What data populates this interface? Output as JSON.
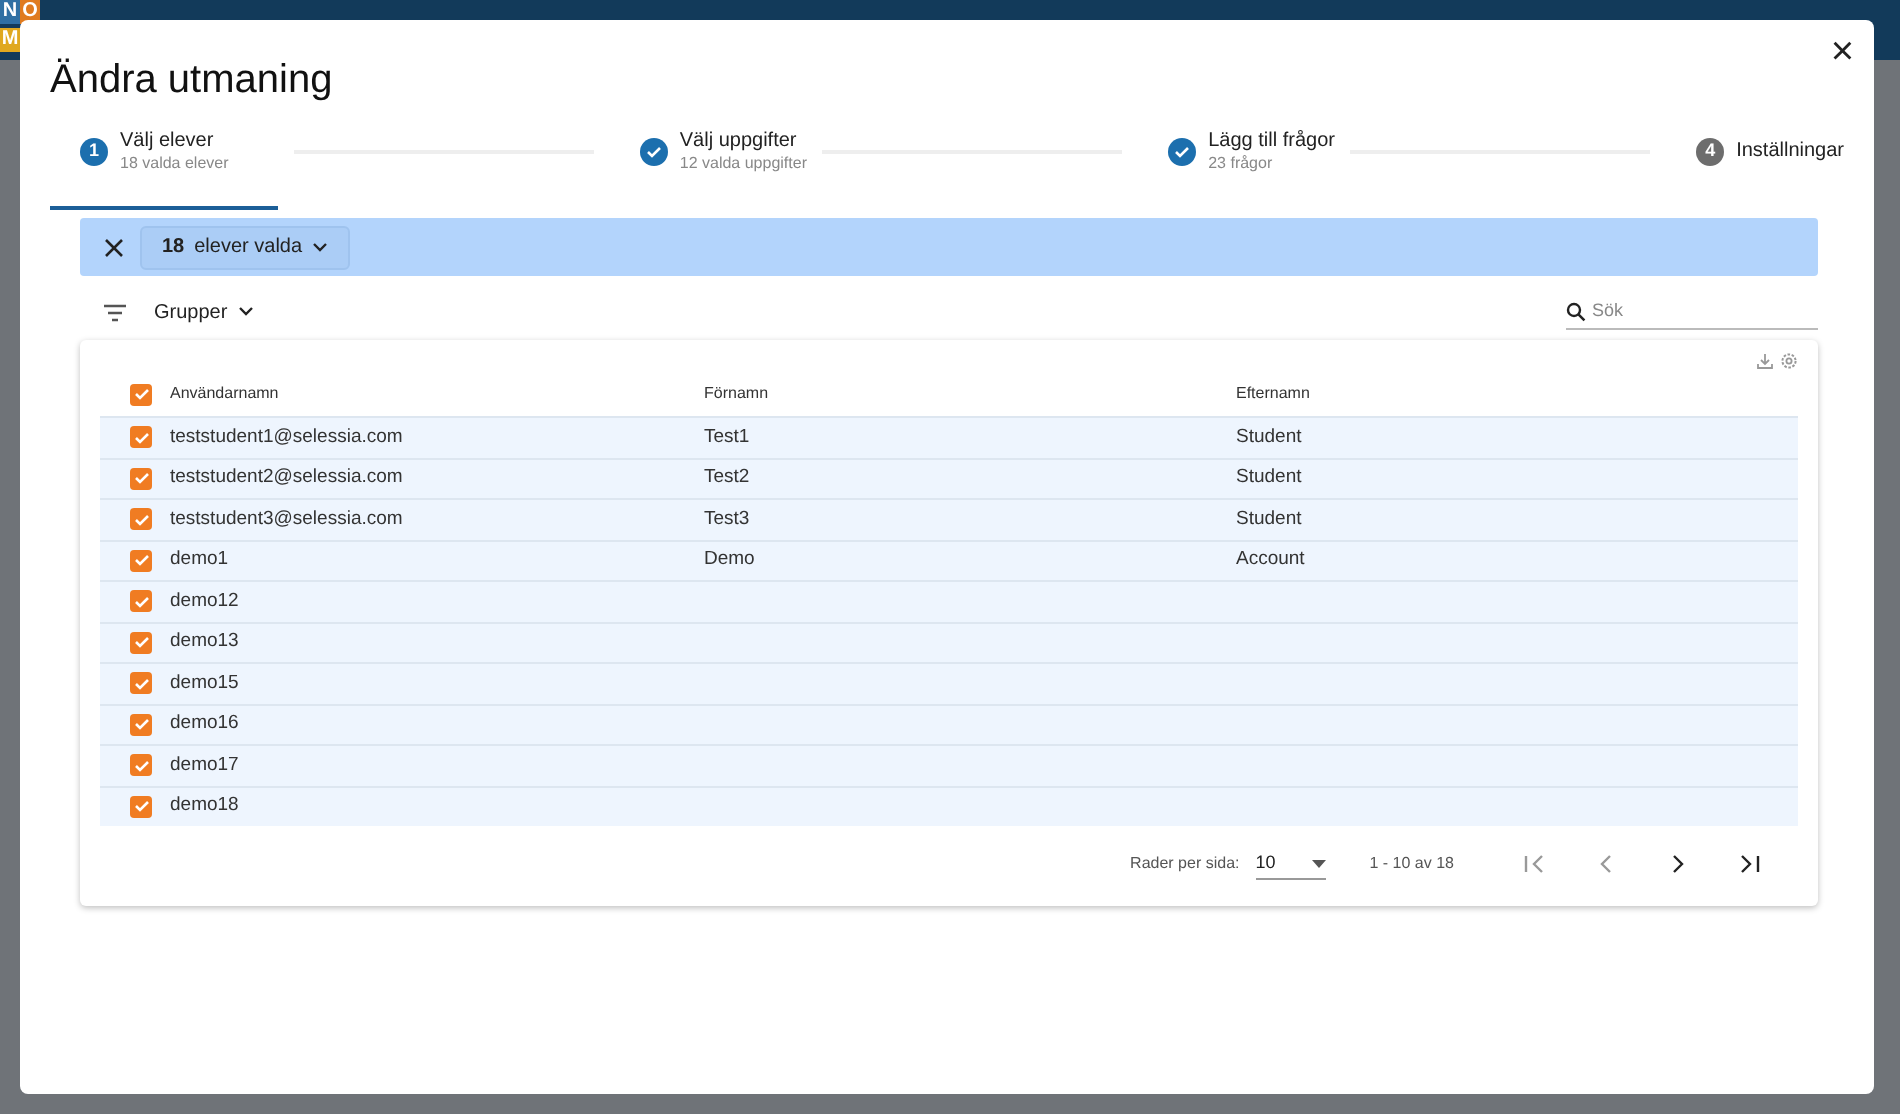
{
  "background": {
    "tiles": [
      {
        "letter": "N",
        "color": "#2f6fa3"
      },
      {
        "letter": "O",
        "color": "#e07b1f"
      },
      {
        "letter": "M",
        "color": "#e0a81f"
      }
    ]
  },
  "dialog": {
    "title": "Ändra utmaning",
    "close": "×"
  },
  "steps": [
    {
      "kind": "active",
      "number": "1",
      "label": "Välj elever",
      "sub": "18 valda elever",
      "selected": true
    },
    {
      "kind": "done",
      "label": "Välj uppgifter",
      "sub": "12 valda uppgifter",
      "selected": false
    },
    {
      "kind": "done",
      "label": "Lägg till frågor",
      "sub": "23 frågor",
      "selected": false
    },
    {
      "kind": "pending",
      "number": "4",
      "label": "Inställningar",
      "selected": false
    }
  ],
  "selection_bar": {
    "count": "18",
    "label": "elever valda"
  },
  "toolbar": {
    "groups": "Grupper",
    "search": {
      "placeholder": "Sök"
    }
  },
  "table": {
    "header_checked": true,
    "columns": [
      "Användarnamn",
      "Förnamn",
      "Efternamn"
    ],
    "rows": [
      {
        "checked": true,
        "cells": [
          "teststudent1@selessia.com",
          "Test1",
          "Student"
        ]
      },
      {
        "checked": true,
        "cells": [
          "teststudent2@selessia.com",
          "Test2",
          "Student"
        ]
      },
      {
        "checked": true,
        "cells": [
          "teststudent3@selessia.com",
          "Test3",
          "Student"
        ]
      },
      {
        "checked": true,
        "cells": [
          "demo1",
          "Demo",
          "Account"
        ]
      },
      {
        "checked": true,
        "cells": [
          "demo12",
          "",
          ""
        ]
      },
      {
        "checked": true,
        "cells": [
          "demo13",
          "",
          ""
        ]
      },
      {
        "checked": true,
        "cells": [
          "demo15",
          "",
          ""
        ]
      },
      {
        "checked": true,
        "cells": [
          "demo16",
          "",
          ""
        ]
      },
      {
        "checked": true,
        "cells": [
          "demo17",
          "",
          ""
        ]
      },
      {
        "checked": true,
        "cells": [
          "demo18",
          "",
          ""
        ]
      }
    ]
  },
  "pagination": {
    "rows_label": "Rader per sida:",
    "rows_value": "10",
    "range": "1 - 10 av 18"
  }
}
